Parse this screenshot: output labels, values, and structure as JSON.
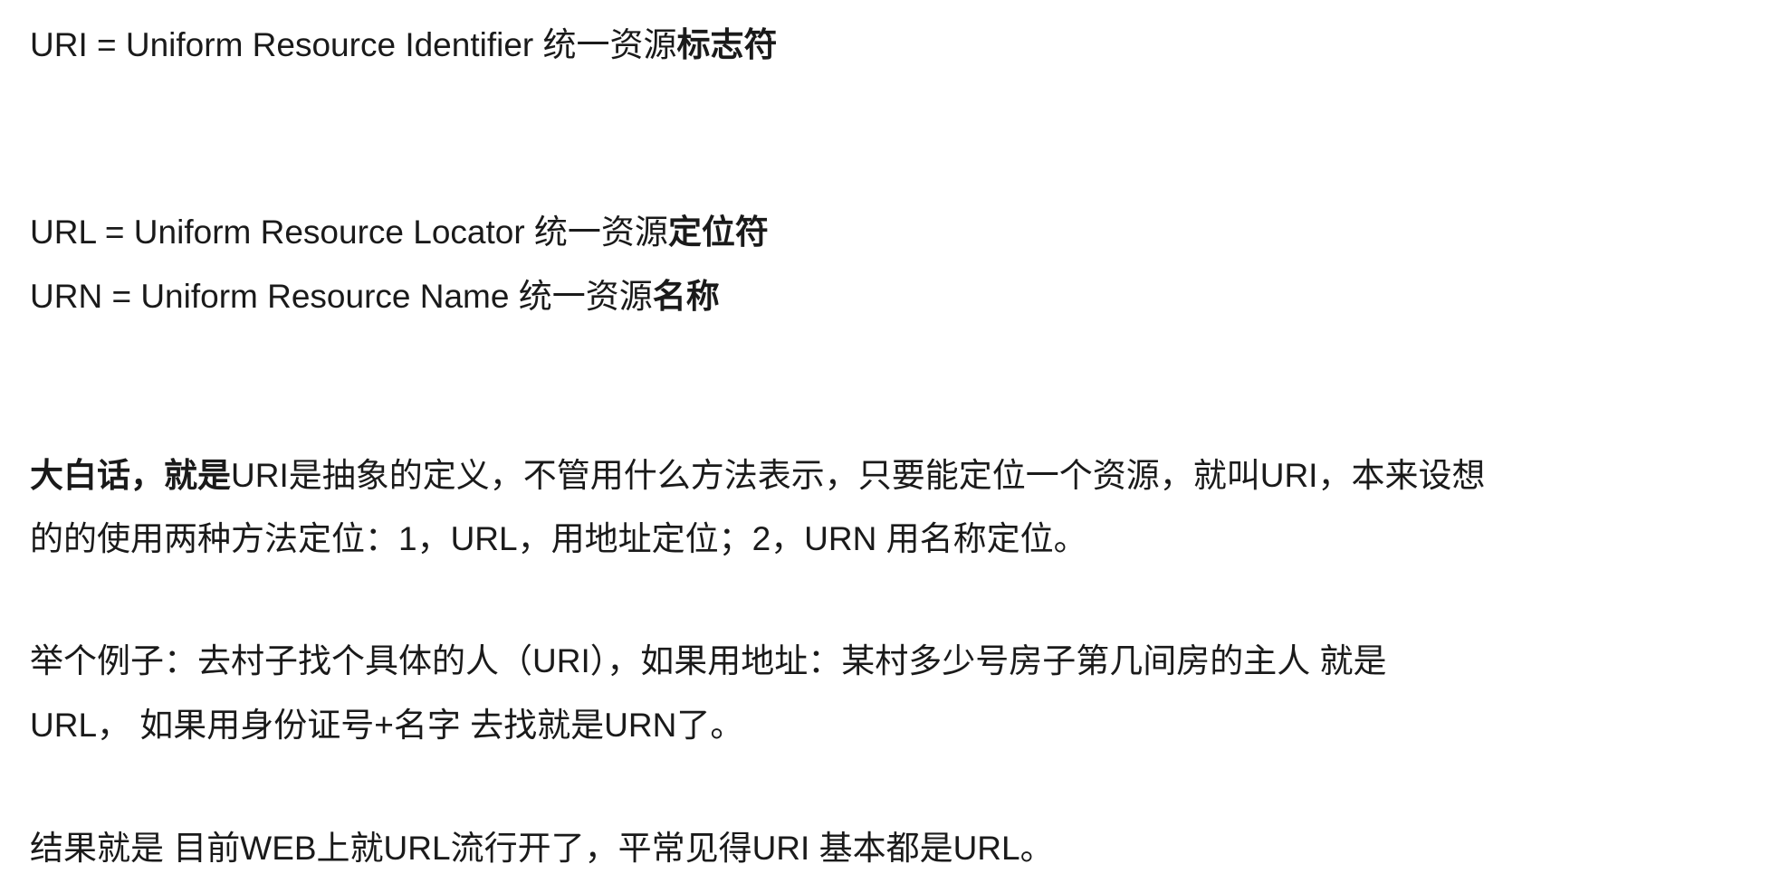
{
  "lines": [
    {
      "normal": "URI = Uniform Resource Identifier 统一资源",
      "bold": "标志符"
    },
    {
      "normal": "URL = Uniform Resource Locator 统一资源",
      "bold": "定位符"
    },
    {
      "normal": "URN = Uniform Resource Name 统一资源",
      "bold": "名称"
    },
    {
      "bold": "大白话，就是",
      "normal": "URI是抽象的定义，不管用什么方法表示，只要能定位一个资源，就叫URI，本来设想"
    },
    {
      "normal": "的的使用两种方法定位：1，URL，用地址定位；2，URN 用名称定位。"
    },
    {
      "normal": "举个例子：去村子找个具体的人（URI），如果用地址：某村多少号房子第几间房的主人 就是"
    },
    {
      "normal": "URL， 如果用身份证号+名字 去找就是URN了。"
    },
    {
      "normal": "结果就是 目前WEB上就URL流行开了，平常见得URI 基本都是URL。"
    }
  ]
}
